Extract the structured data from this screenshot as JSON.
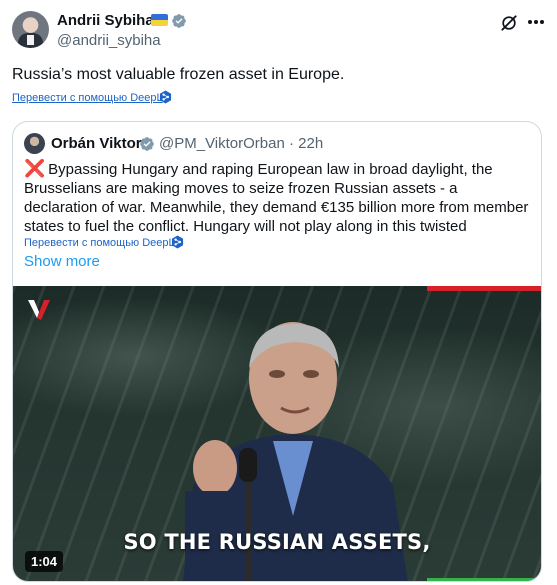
{
  "tweet": {
    "author_name": "Andrii Sybiha",
    "author_handle": "@andrii_sybiha",
    "text": "Russia’s most valuable frozen asset in Europe.",
    "translate_label": "Перевести с помощью DeepL"
  },
  "quoted": {
    "author_name": "Orbán Viktor",
    "meta": "@PM_ViktorOrban · 22h",
    "cross_glyph": "❌",
    "text": "Bypassing Hungary and raping European law in broad daylight, the Brusselians are making moves to seize frozen Russian assets - a declaration of war. Meanwhile, they demand €135 billion more from member states to fuel the conflict. Hungary will not play along in this twisted",
    "translate_label": "Перевести с помощью DeepL",
    "show_more": "Show more"
  },
  "video": {
    "caption": "SO THE RUSSIAN ASSETS,",
    "duration": "1:04"
  },
  "icons": {
    "verified": "verified-badge-icon",
    "grok": "grok-icon",
    "more": "more-dots-icon",
    "deepl": "deepl-icon",
    "flag": "ukraine-flag-icon",
    "channel_logo": "channel-logo-icon"
  },
  "colors": {
    "link": "#1d9bf0",
    "translate": "#1d64c7",
    "verified": "#829aab",
    "secondary_text": "#536471",
    "border": "#cfd9de",
    "video_red": "#d6202a",
    "video_green": "#36b24a"
  }
}
